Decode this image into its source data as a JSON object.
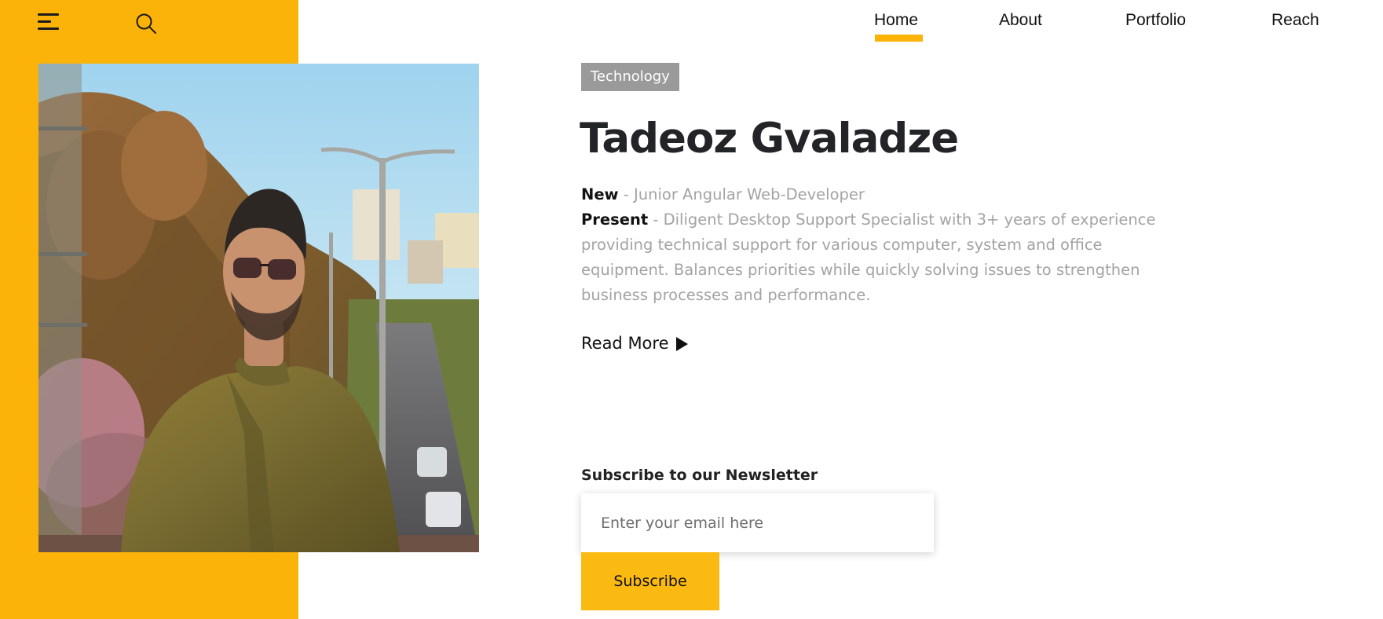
{
  "nav": {
    "items": [
      {
        "label": "Home",
        "active": true
      },
      {
        "label": "About"
      },
      {
        "label": "Portfolio"
      },
      {
        "label": "Reach"
      }
    ]
  },
  "colors": {
    "accent": "#fbb30a",
    "tag_background": "#9a9a9a",
    "heading": "#222428",
    "muted_text": "#a3a3a3"
  },
  "icons": {
    "menu": "hamburger-menu-icon",
    "search": "search-icon",
    "read_more": "play-arrow-icon"
  },
  "hero": {
    "tag": "Technology",
    "title": "Tadeoz Gvaladze",
    "new_label": "New",
    "new_text": " - Junior Angular Web-Developer",
    "present_label": "Present",
    "present_text": " - Diligent Desktop Support Specialist with 3+ years of experience providing technical support for various computer, system and office equipment. Balances priorities while quickly solving issues to strengthen business processes and performance.",
    "read_more": "Read More"
  },
  "newsletter": {
    "heading": "Subscribe to our Newsletter",
    "email_placeholder": "Enter your email here",
    "email_value": "",
    "subscribe_label": "Subscribe"
  }
}
